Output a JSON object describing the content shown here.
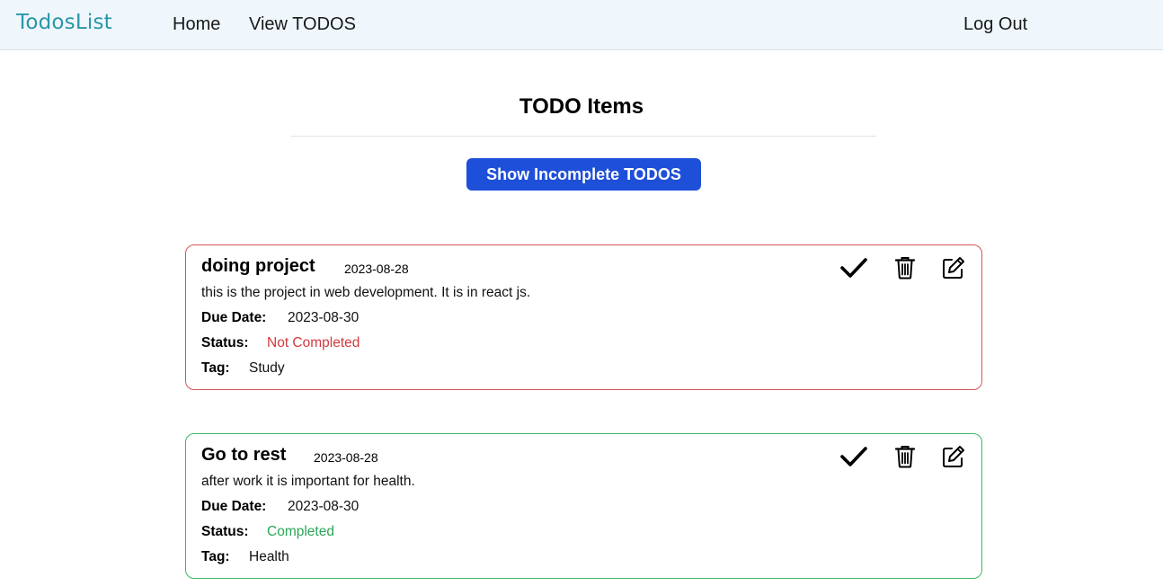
{
  "navbar": {
    "brand": "TodosList",
    "links": [
      "Home",
      "View TODOS"
    ],
    "logout": "Log Out"
  },
  "page": {
    "title": "TODO Items",
    "filter_button": "Show Incomplete TODOS"
  },
  "labels": {
    "due_date": "Due Date:",
    "status": "Status:",
    "tag": "Tag:"
  },
  "todos": [
    {
      "title": "doing project",
      "created": "2023-08-28",
      "description": "this is the project in web development. It is in react js.",
      "due_date": "2023-08-30",
      "status": "Not Completed",
      "tag": "Study",
      "status_color": "#d23a3f",
      "border_color": "#d9545a"
    },
    {
      "title": "Go to rest",
      "created": "2023-08-28",
      "description": "after work it is important for health.",
      "due_date": "2023-08-30",
      "status": "Completed",
      "tag": "Health",
      "status_color": "#2aa558",
      "border_color": "#3db865"
    }
  ],
  "icons": [
    "check-icon",
    "trash-icon",
    "edit-icon"
  ],
  "colors": {
    "brand": "#2a96a8",
    "navbar_bg": "#eff7fc",
    "primary_button": "#1e4fd8"
  }
}
